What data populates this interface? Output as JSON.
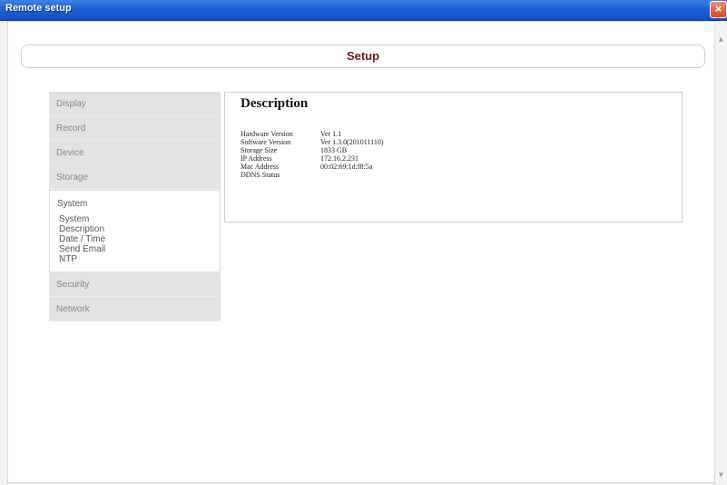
{
  "window": {
    "title": "Remote setup",
    "close_symbol": "×"
  },
  "header": {
    "title": "Setup"
  },
  "sidebar": {
    "items": [
      {
        "label": "Display"
      },
      {
        "label": "Record"
      },
      {
        "label": "Device"
      },
      {
        "label": "Storage"
      },
      {
        "label": "System",
        "sub": [
          "System",
          "Description",
          "Date / Time",
          "Send Email",
          "NTP"
        ]
      },
      {
        "label": "Security"
      },
      {
        "label": "Network"
      }
    ]
  },
  "description": {
    "title": "Description",
    "rows": [
      {
        "key": "Hardware Version",
        "value": "Ver 1.1"
      },
      {
        "key": "Software Version",
        "value": "Ver 1.3.0(201011110)"
      },
      {
        "key": "Storage Size",
        "value": "1833 GB"
      },
      {
        "key": "IP Address",
        "value": "172.16.2.231"
      },
      {
        "key": "Mac Address",
        "value": "00:02:69:1d:f8:5a"
      },
      {
        "key": "DDNS Status",
        "value": ""
      }
    ]
  },
  "colors": {
    "titlebar": "#1d5fd6",
    "header_text": "#7a1a1a",
    "sidebar_bg": "#e3e3e3"
  },
  "icons": {
    "close": "close-icon",
    "scroll_up": "scroll-up-arrow-icon",
    "scroll_down": "scroll-down-arrow-icon"
  }
}
